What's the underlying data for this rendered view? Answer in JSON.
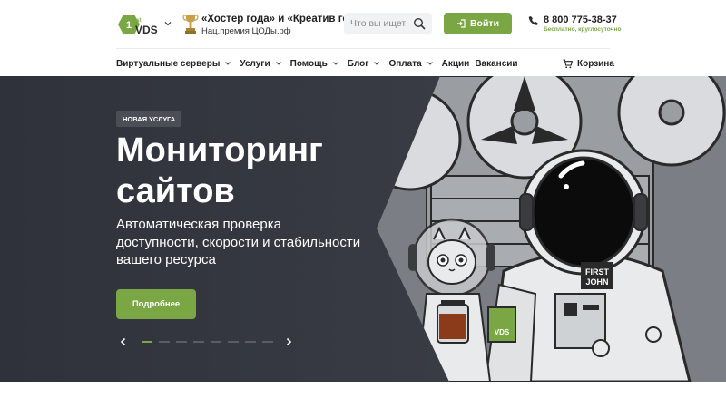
{
  "header": {
    "logo_alt": "1st VDS",
    "award": {
      "title": "«Хостер года» и «Креатив года»",
      "subtitle": "Нац.премия ЦОДы.рф"
    },
    "search": {
      "placeholder": "Что вы ищет"
    },
    "login_label": "Войти",
    "phone": "8 800 775-38-37",
    "phone_note": "Бесплатно, круглосуточно"
  },
  "nav": {
    "items": [
      {
        "label": "Виртуальные серверы",
        "has_dropdown": true
      },
      {
        "label": "Услуги",
        "has_dropdown": true
      },
      {
        "label": "Помощь",
        "has_dropdown": true
      },
      {
        "label": "Блог",
        "has_dropdown": true
      },
      {
        "label": "Оплата",
        "has_dropdown": true
      },
      {
        "label": "Акции",
        "has_dropdown": false
      },
      {
        "label": "Вакансии",
        "has_dropdown": false
      }
    ],
    "cart_label": "Корзина"
  },
  "hero": {
    "badge": "НОВАЯ УСЛУГА",
    "title_line1": "Мониторинг",
    "title_line2": "сайтов",
    "subtitle_line1": "Автоматическая проверка",
    "subtitle_line2": "доступности, скорости и стабильности",
    "subtitle_line3": "вашего ресурса",
    "cta_label": "Подробнее",
    "slides_total": 8,
    "active_slide": 1,
    "illustration": {
      "helmet_text_line1": "FIRST",
      "helmet_text_line2": "JOHN",
      "sleeve_text": "VDS"
    }
  },
  "colors": {
    "accent": "#7aa744",
    "hero_bg": "#2f323a",
    "text_dark": "#222222"
  }
}
